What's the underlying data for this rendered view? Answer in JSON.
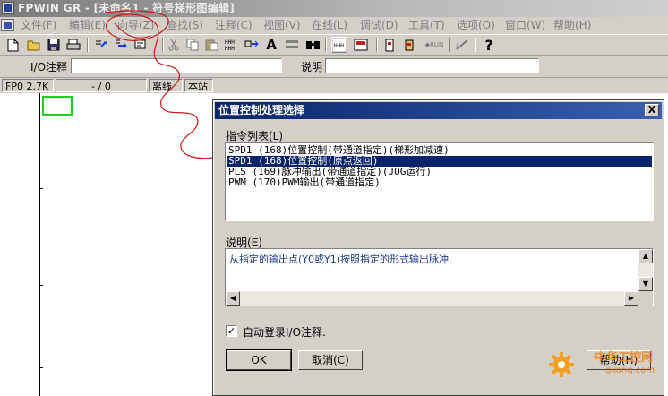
{
  "app": {
    "title": "FPWIN GR - [未命名1 - 符号梯形图编辑]"
  },
  "menu": [
    {
      "label": "文件(F)"
    },
    {
      "label": "编辑(E)"
    },
    {
      "label": "向导(Z)"
    },
    {
      "label": "查找(S)"
    },
    {
      "label": "注释(C)"
    },
    {
      "label": "视图(V)"
    },
    {
      "label": "在线(L)"
    },
    {
      "label": "调试(D)"
    },
    {
      "label": "工具(T)"
    },
    {
      "label": "选项(O)"
    },
    {
      "label": "窗口(W)"
    },
    {
      "label": "帮助(H)"
    }
  ],
  "toolbar": {
    "icons": [
      "new-file-icon",
      "open-folder-icon",
      "save-icon",
      "print-icon",
      "wizard-icon",
      "compile-icon",
      "monitor-icon",
      "cut-icon",
      "copy-icon",
      "paste-icon",
      "block-copy-icon",
      "block-move-icon",
      "text-icon",
      "line-icon",
      "find-icon",
      "ladder-view-icon",
      "monitor-panel-icon",
      "plc-read-icon",
      "plc-write-icon",
      "run-mode-icon",
      "run-prog-icon",
      "help-icon"
    ],
    "text_a": "A",
    "run_label": "◆RUN",
    "help_glyph": "?"
  },
  "io_row": {
    "io_label": "I/O注释",
    "io_value": "",
    "desc_label": "说明",
    "desc_value": ""
  },
  "status": {
    "plc_type": "FP0 2.7K",
    "position": "- / 0",
    "mode": "离线",
    "station": "本站"
  },
  "dialog": {
    "title": "位置控制处理选择",
    "close_glyph": "X",
    "list_label": "指令列表(L)",
    "instructions": [
      {
        "text": "SPD1 (168)位置控制(带通道指定)(梯形加减速)"
      },
      {
        "text": "SPD1 (168)位置控制(原点返回)",
        "selected": true
      },
      {
        "text": "PLS  (169)脉冲输出(带通道指定)(JOG运行)"
      },
      {
        "text": "PWM  (170)PWM输出(带通道指定)"
      }
    ],
    "desc_label": "说明(E)",
    "description": "从指定的输出点(Y0或Y1)按照指定的形式输出脉冲.",
    "auto_register_label": "自动登录I/O注释.",
    "auto_register_checked": "✓",
    "ok_label": "OK",
    "cancel_label": "取消(C)",
    "help_label": "帮助(H)"
  },
  "watermark": {
    "text": "中华工控网",
    "url": "gkong.com"
  }
}
